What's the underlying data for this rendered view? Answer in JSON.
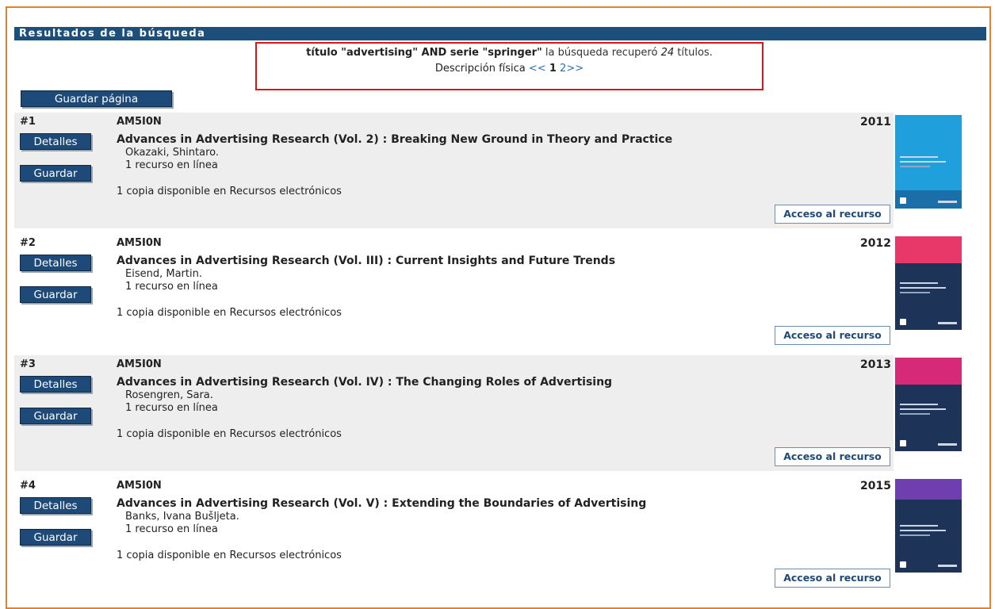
{
  "header": {
    "title": "Resultados de la búsqueda"
  },
  "query": {
    "expression": "título \"advertising\" AND serie \"springer\"",
    "text_before_count": "la búsqueda recuperó",
    "count": "24",
    "text_after_count": "títulos.",
    "sort_label": "Descripción física",
    "prev": "<<",
    "current_page": "1",
    "next_page": "2",
    "next": ">>"
  },
  "save_page_label": "Guardar página",
  "labels": {
    "details": "Detalles",
    "save": "Guardar",
    "access": "Acceso al recurso"
  },
  "records": [
    {
      "number": "#1",
      "call_number": "AM5I0N",
      "year": "2011",
      "title": "Advances in Advertising Research (Vol. 2) : Breaking New Ground in Theory and Practice",
      "author": "Okazaki, Shintaro.",
      "online": "1 recurso en línea",
      "copies": "1 copia disponible en Recursos electrónicos",
      "cover_color": "#1f9fdc"
    },
    {
      "number": "#2",
      "call_number": "AM5I0N",
      "year": "2012",
      "title": "Advances in Advertising Research (Vol. III) : Current Insights and Future Trends",
      "author": "Eisend, Martin.",
      "online": "1 recurso en línea",
      "copies": "1 copia disponible en Recursos electrónicos",
      "cover_color": "#e8386a"
    },
    {
      "number": "#3",
      "call_number": "AM5I0N",
      "year": "2013",
      "title": "Advances in Advertising Research (Vol. IV) : The Changing Roles of Advertising",
      "author": "Rosengren, Sara.",
      "online": "1 recurso en línea",
      "copies": "1 copia disponible en Recursos electrónicos",
      "cover_color": "#d62a78"
    },
    {
      "number": "#4",
      "call_number": "AM5I0N",
      "year": "2015",
      "title": "Advances in Advertising Research (Vol. V) : Extending the Boundaries of Advertising",
      "author": "Banks, Ivana Bušljeta.",
      "online": "1 recurso en línea",
      "copies": "1 copia disponible en Recursos electrónicos",
      "cover_color": "#6f3fb0"
    }
  ],
  "colors": {
    "header_bg": "#1b4f7c",
    "button_bg": "#1d4a78",
    "frame_border": "#e0832e",
    "query_border": "#d81414",
    "row_shade": "#eeeeee"
  }
}
